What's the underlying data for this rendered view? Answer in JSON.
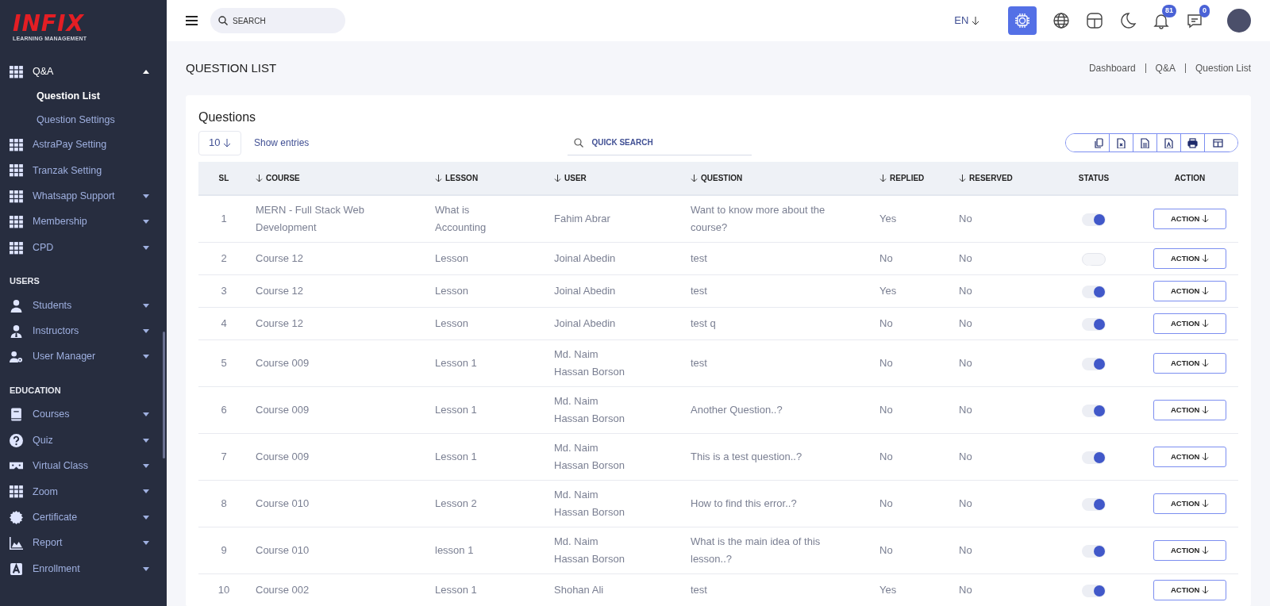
{
  "sidebar": {
    "logo": {
      "title": "INFIX",
      "subtitle": "LEARNING MANAGEMENT"
    },
    "sections": [
      {
        "items": [
          {
            "label": "Q&A",
            "kind": "grid",
            "expanded": true,
            "children": [
              {
                "label": "Question List",
                "selected": true
              },
              {
                "label": "Question Settings",
                "selected": false
              }
            ]
          },
          {
            "label": "AstraPay Setting",
            "kind": "grid"
          },
          {
            "label": "Tranzak Setting",
            "kind": "grid"
          },
          {
            "label": "Whatsapp Support",
            "kind": "grid",
            "expanded": false
          },
          {
            "label": "Membership",
            "kind": "grid",
            "expanded": false
          },
          {
            "label": "CPD",
            "kind": "grid",
            "expanded": false
          }
        ]
      },
      {
        "heading": "USERS",
        "items": [
          {
            "label": "Students",
            "kind": "person",
            "expanded": false
          },
          {
            "label": "Instructors",
            "kind": "tie-person",
            "expanded": false
          },
          {
            "label": "User Manager",
            "kind": "person-gear",
            "expanded": false
          }
        ]
      },
      {
        "heading": "EDUCATION",
        "items": [
          {
            "label": "Courses",
            "kind": "book",
            "expanded": false
          },
          {
            "label": "Quiz",
            "kind": "question",
            "expanded": false
          },
          {
            "label": "Virtual Class",
            "kind": "goggles",
            "expanded": false
          },
          {
            "label": "Zoom",
            "kind": "grid",
            "expanded": false
          },
          {
            "label": "Certificate",
            "kind": "seal",
            "expanded": false
          },
          {
            "label": "Report",
            "kind": "chart",
            "expanded": false
          },
          {
            "label": "Enrollment",
            "kind": "letter",
            "expanded": false
          }
        ]
      }
    ]
  },
  "topbar": {
    "search": {
      "placeholder": "SEARCH"
    },
    "language": "EN",
    "notifications": "81",
    "messages": "0"
  },
  "page": {
    "title": "QUESTION LIST",
    "breadcrumb": [
      "Dashboard",
      "Q&A",
      "Question List"
    ]
  },
  "card": {
    "title": "Questions",
    "entries": "10",
    "entries_label": "Show entries",
    "quick_search": {
      "placeholder": "QUICK SEARCH"
    },
    "table": {
      "columns": [
        {
          "label": "SL",
          "sortable": false
        },
        {
          "label": "COURSE",
          "sortable": true
        },
        {
          "label": "LESSON",
          "sortable": true
        },
        {
          "label": "USER",
          "sortable": true
        },
        {
          "label": "QUESTION",
          "sortable": true
        },
        {
          "label": "REPLIED",
          "sortable": true
        },
        {
          "label": "RESERVED",
          "sortable": true
        },
        {
          "label": "STATUS",
          "sortable": false
        },
        {
          "label": "ACTION",
          "sortable": false
        }
      ],
      "rows": [
        {
          "sl": "1",
          "course": "MERN - Full Stack Web Development",
          "lesson": "What is Accounting",
          "user": "Fahim Abrar",
          "question": "Want to know more about the course?",
          "replied": "Yes",
          "reserved": "No",
          "status": true,
          "action": "ACTION"
        },
        {
          "sl": "2",
          "course": "Course 12",
          "lesson": "Lesson",
          "user": "Joinal Abedin",
          "question": "test",
          "replied": "No",
          "reserved": "No",
          "status": false,
          "action": "ACTION"
        },
        {
          "sl": "3",
          "course": "Course 12",
          "lesson": "Lesson",
          "user": "Joinal Abedin",
          "question": "test",
          "replied": "Yes",
          "reserved": "No",
          "status": true,
          "action": "ACTION"
        },
        {
          "sl": "4",
          "course": "Course 12",
          "lesson": "Lesson",
          "user": "Joinal Abedin",
          "question": "test q",
          "replied": "No",
          "reserved": "No",
          "status": true,
          "action": "ACTION"
        },
        {
          "sl": "5",
          "course": "Course 009",
          "lesson": "Lesson 1",
          "user": "Md. Naim Hassan Borson",
          "question": "test",
          "replied": "No",
          "reserved": "No",
          "status": true,
          "action": "ACTION"
        },
        {
          "sl": "6",
          "course": "Course 009",
          "lesson": "Lesson 1",
          "user": "Md. Naim Hassan Borson",
          "question": "Another Question..?",
          "replied": "No",
          "reserved": "No",
          "status": true,
          "action": "ACTION"
        },
        {
          "sl": "7",
          "course": "Course 009",
          "lesson": "Lesson 1",
          "user": "Md. Naim Hassan Borson",
          "question": "This is a test question..?",
          "replied": "No",
          "reserved": "No",
          "status": true,
          "action": "ACTION"
        },
        {
          "sl": "8",
          "course": "Course 010",
          "lesson": "Lesson 2",
          "user": "Md. Naim Hassan Borson",
          "question": "How to find this error..?",
          "replied": "No",
          "reserved": "No",
          "status": true,
          "action": "ACTION"
        },
        {
          "sl": "9",
          "course": "Course 010",
          "lesson": "lesson 1",
          "user": "Md. Naim Hassan Borson",
          "question": "What is the main idea of this lesson..?",
          "replied": "No",
          "reserved": "No",
          "status": true,
          "action": "ACTION"
        },
        {
          "sl": "10",
          "course": "Course 002",
          "lesson": "Lesson 1",
          "user": "Shohan Ali",
          "question": "test",
          "replied": "Yes",
          "reserved": "No",
          "status": true,
          "action": "ACTION"
        }
      ]
    }
  }
}
